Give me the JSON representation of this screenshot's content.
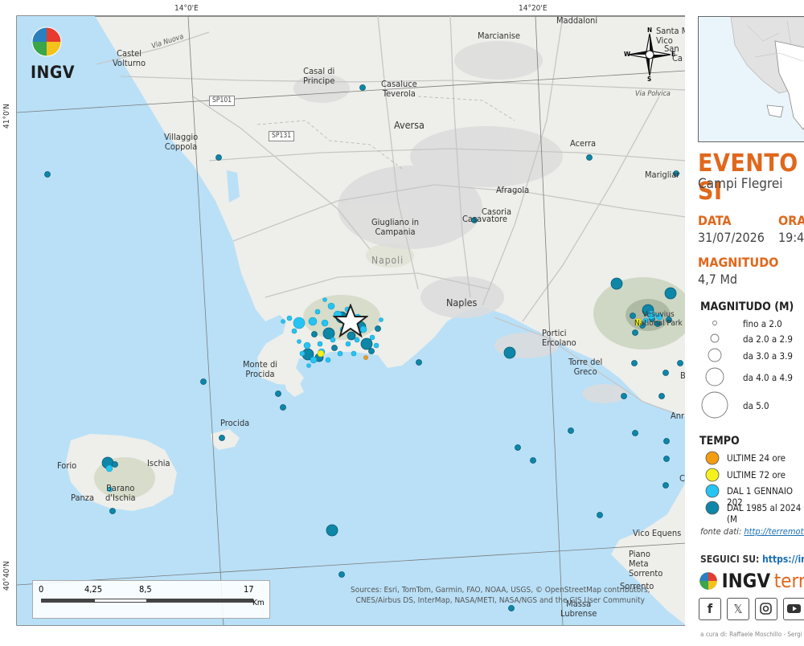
{
  "map": {
    "graticule": {
      "lon_14_00": "14°0'E",
      "lon_14_20": "14°20'E",
      "lat_41_00": "41°0'N",
      "lat_40_40": "40°40'N"
    },
    "roads": {
      "sp101": "SP101",
      "sp131": "SP131",
      "via_nuova": "Via Nuova",
      "via_polvica": "Via Polvica"
    },
    "places": {
      "castel_volturno": "Castel\nVolturno",
      "casal_di_principe": "Casal di\nPrincipe",
      "marcianise": "Marcianise",
      "maddaloni": "Maddaloni",
      "santa_maria_vico": "Santa Mari\nVico",
      "san": "San",
      "ca": "Ca",
      "casaluce_teverola": "Casaluce\nTeverola",
      "villaggio_coppola": "Villaggio\nCoppola",
      "aversa": "Aversa",
      "acerra": "Acerra",
      "marigliano": "Marigliar",
      "afragola": "Afragola",
      "casoria": "Casoria",
      "casavatore": "Casavatore",
      "giugliano": "Giugliano in\nCampania",
      "napoli_grey": "Napoli",
      "naples": "Naples",
      "portici_ercolano": "Portici\nErcolano",
      "vesuvius_park": "Vesuvius\nNational Park",
      "torre_del_greco": "Torre del\nGreco",
      "monte_di_procida": "Monte di\nProcida",
      "procida": "Procida",
      "forio": "Forio",
      "ischia": "Ischia",
      "barano": "Barano\nd'Ischia",
      "panza": "Panza",
      "vico_equense": "Vico Equens",
      "piano_meta_sorrento": "Piano\nMeta\nSorrento",
      "sorrento": "Sorrento",
      "massa_lubrense": "Massa\nLubrense",
      "b_cut": "B",
      "an_cut": "Anr",
      "c_cut": "C"
    },
    "logo_text": "INGV",
    "compass": {
      "n": "N",
      "s": "S",
      "e": "E",
      "w": "W"
    },
    "scale_bar": {
      "labels": [
        "0",
        "4,25",
        "8,5",
        "17"
      ],
      "unit": "Km"
    },
    "sources": "Sources: Esri, TomTom, Garmin, FAO, NOAA, USGS, © OpenStreetMap contributors,\nCNES/Airbus DS, InterMap, NASA/METI, NASA/NGS and the GIS User Community",
    "epicenter_icon": "star-icon"
  },
  "panel": {
    "title": "EVENTO SI",
    "area": "Campi Flegrei",
    "date_label": "DATA",
    "date_value": "31/07/2026",
    "time_label": "ORA",
    "time_value": "19:4",
    "magnitude_label": "MAGNITUDO",
    "magnitude_value": "4,7 Md",
    "legend_magnitude_title": "MAGNITUDO (M)",
    "magnitude_classes": [
      "fino a 2.0",
      "da 2.0 a 2.9",
      "da 3.0 a 3.9",
      "da 4.0 a 4.9",
      "da 5.0"
    ],
    "tempo_title": "TEMPO",
    "tempo_classes": [
      {
        "label": "ULTIME 24 ore",
        "color": "#f39c12"
      },
      {
        "label": "ULTIME 72 ore",
        "color": "#f4f11c"
      },
      {
        "label": "DAL 1 GENNAIO 202",
        "color": "#25c4f2"
      },
      {
        "label": "DAL 1985 al 2024 (M",
        "color": "#0e86a8"
      }
    ],
    "fonte_label": "fonte dati:",
    "fonte_link": "http://terremoti",
    "seguici_label": "SEGUICI SU:",
    "seguici_link": "https://ingv",
    "brand_ingv": "INGV",
    "brand_terr": "terr",
    "social_icons": [
      "facebook-icon",
      "x-icon",
      "instagram-icon",
      "youtube-icon"
    ],
    "credit": "a cura di: Raffaele Moschillo - Sergi"
  },
  "colors": {
    "sea": "#b9e0f7",
    "land": "#eeeeea",
    "orange": "#e0681c",
    "recent": "#25c4f2",
    "historic": "#0e86a8",
    "yellow": "#f4f11c"
  }
}
